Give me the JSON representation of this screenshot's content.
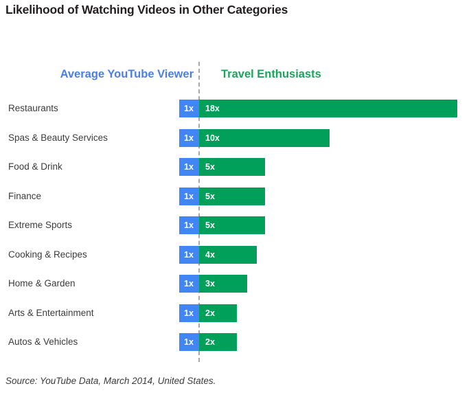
{
  "chart_data": {
    "type": "bar",
    "title": "Likelihood of Watching Videos in Other Categories",
    "xlabel": "",
    "ylabel": "",
    "grid": false,
    "legend_position": "top",
    "orientation": "horizontal",
    "note": "Diverging/paired horizontal bars; left baseline series fixed at 1x, right series shows multiplier",
    "categories": [
      "Restaurants",
      "Spas & Beauty Services",
      "Food & Drink",
      "Finance",
      "Extreme Sports",
      "Cooking & Recipes",
      "Home & Garden",
      "Arts & Entertainment",
      "Autos & Vehicles"
    ],
    "series": [
      {
        "name": "Average YouTube Viewer",
        "color": "#4285f4",
        "values": [
          1,
          1,
          1,
          1,
          1,
          1,
          1,
          1,
          1
        ],
        "labels": [
          "1x",
          "1x",
          "1x",
          "1x",
          "1x",
          "1x",
          "1x",
          "1x",
          "1x"
        ]
      },
      {
        "name": "Travel Enthusiasts",
        "color": "#00a05b",
        "values": [
          18,
          10,
          5,
          5,
          5,
          4,
          3,
          2,
          2
        ],
        "labels": [
          "18x",
          "10x",
          "5x",
          "5x",
          "5x",
          "4x",
          "3x",
          "2x",
          "2x"
        ]
      }
    ],
    "bar_pixel_widths": {
      "blue": [
        29,
        29,
        29,
        29,
        29,
        29,
        29,
        29,
        29
      ],
      "green": [
        376,
        190,
        96,
        96,
        96,
        84,
        70,
        55,
        55
      ]
    }
  },
  "legend": {
    "left_label": "Average YouTube Viewer",
    "right_label": "Travel Enthusiasts",
    "left_color": "#4a7fe8",
    "right_color": "#1da35c"
  },
  "footer": {
    "source": "Source: YouTube Data, March 2014, United States."
  },
  "colors": {
    "blue_bar": "#4285f4",
    "green_bar": "#00a05b",
    "divider": "#a8a8a8",
    "background": "#ffffff",
    "text": "#231f20"
  }
}
